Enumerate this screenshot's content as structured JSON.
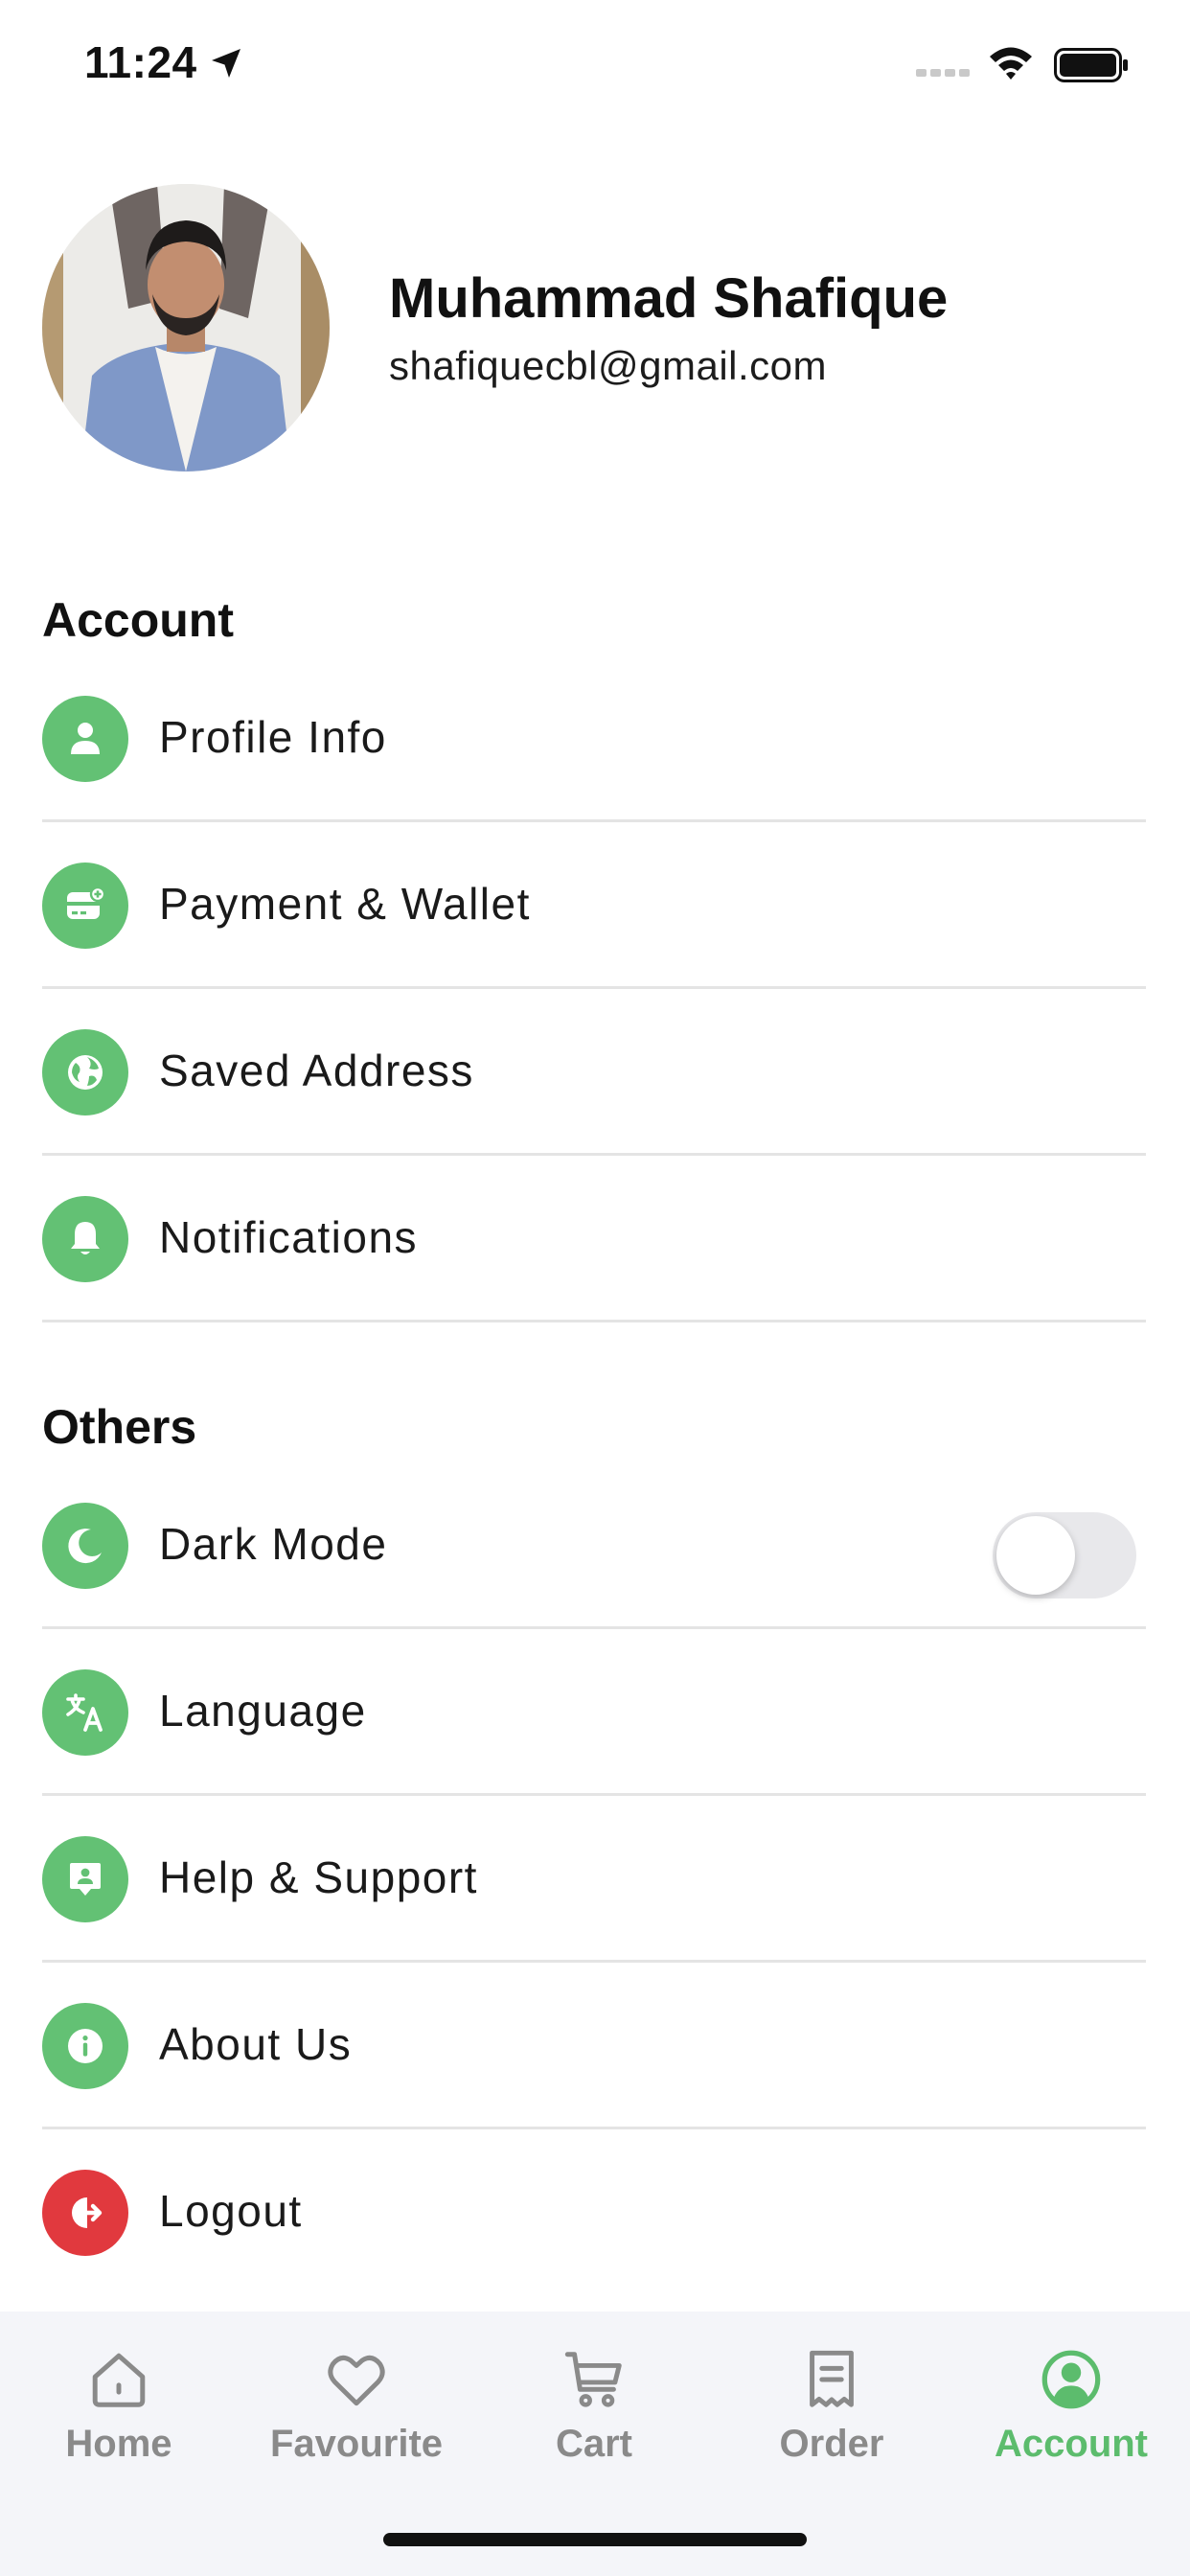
{
  "status_bar": {
    "time": "11:24"
  },
  "profile": {
    "name": "Muhammad Shafique",
    "email": "shafiquecbl@gmail.com"
  },
  "sections": {
    "account_title": "Account",
    "others_title": "Others"
  },
  "account_items": [
    {
      "label": "Profile Info",
      "icon": "person-icon"
    },
    {
      "label": "Payment & Wallet",
      "icon": "wallet-icon"
    },
    {
      "label": "Saved Address",
      "icon": "globe-icon"
    },
    {
      "label": "Notifications",
      "icon": "bell-icon"
    }
  ],
  "others_items": [
    {
      "label": "Dark Mode",
      "icon": "moon-icon",
      "toggle_on": false
    },
    {
      "label": "Language",
      "icon": "translate-icon"
    },
    {
      "label": "Help & Support",
      "icon": "support-icon"
    },
    {
      "label": "About Us",
      "icon": "info-icon"
    },
    {
      "label": "Logout",
      "icon": "logout-icon"
    }
  ],
  "bottom_nav": [
    {
      "label": "Home",
      "icon": "home-icon",
      "active": false
    },
    {
      "label": "Favourite",
      "icon": "heart-icon",
      "active": false
    },
    {
      "label": "Cart",
      "icon": "cart-icon",
      "active": false
    },
    {
      "label": "Order",
      "icon": "receipt-icon",
      "active": false
    },
    {
      "label": "Account",
      "icon": "account-icon",
      "active": true
    }
  ],
  "colors": {
    "accent": "#63c174",
    "danger": "#e1393e",
    "nav_active": "#5cbc6d",
    "nav_inactive": "#8a8a8a"
  }
}
